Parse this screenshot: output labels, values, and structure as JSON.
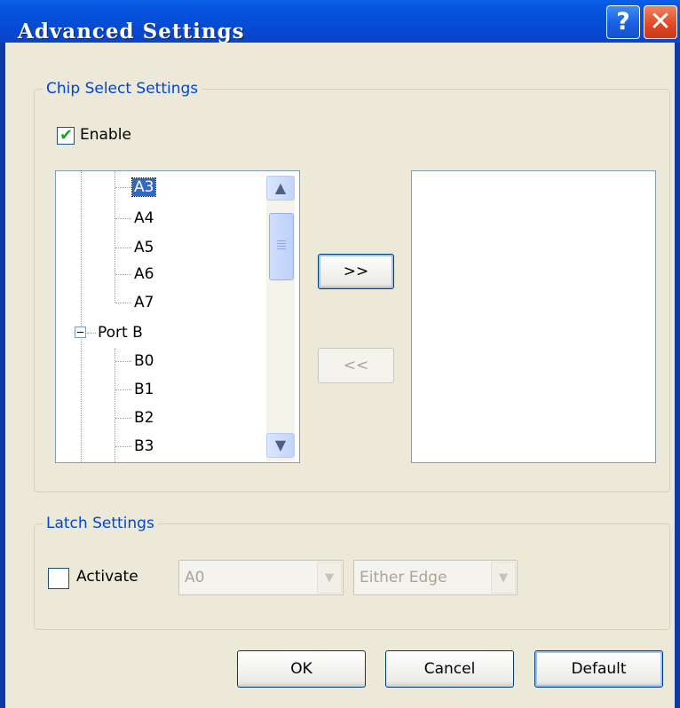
{
  "window": {
    "title": "Advanced Settings",
    "help_glyph": "?",
    "close_glyph": "✕"
  },
  "chip_select": {
    "legend": "Chip Select Settings",
    "enable_label": "Enable",
    "enable_checked": true,
    "tree": {
      "items_a": [
        "A3",
        "A4",
        "A5",
        "A6",
        "A7"
      ],
      "selected": "A3",
      "port_b_label": "Port B",
      "items_b": [
        "B0",
        "B1",
        "B2",
        "B3"
      ]
    },
    "add_label": ">>",
    "remove_label": "<<",
    "right_list_items": []
  },
  "latch": {
    "legend": "Latch Settings",
    "activate_label": "Activate",
    "activate_checked": false,
    "pin_value": "A0",
    "edge_value": "Either Edge"
  },
  "footer": {
    "ok_label": "OK",
    "cancel_label": "Cancel",
    "default_label": "Default"
  },
  "colors": {
    "titlebar": "#0a46cf",
    "legend_text": "#0046d5",
    "selection": "#316ac5",
    "dialog_bg": "#ece9d8"
  }
}
